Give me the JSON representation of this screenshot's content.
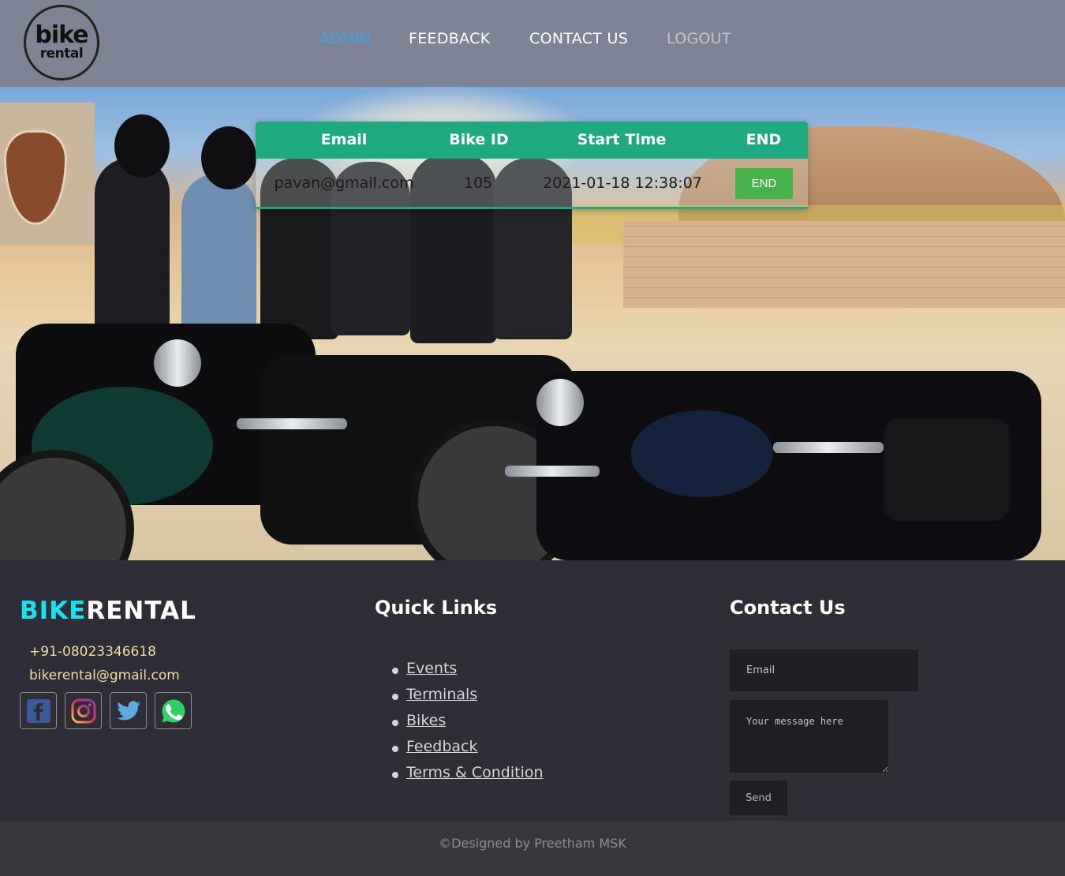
{
  "logo": {
    "line1": "bike",
    "line2": "rental"
  },
  "nav": {
    "admin": "ADMIN",
    "feedback": "FEEDBACK",
    "contact": "CONTACT US",
    "logout": "LOGOUT"
  },
  "table": {
    "headers": [
      "Email",
      "Bike ID",
      "Start Time",
      "END"
    ],
    "rows": [
      {
        "email": "pavan@gmail.com",
        "bike_id": "105",
        "start_time": "2021-01-18 12:38:07",
        "action": "END"
      }
    ]
  },
  "footer": {
    "brand_part1": "BIKE",
    "brand_part2": "RENTAL",
    "phone": "+91-08023346618",
    "email": "bikerental@gmail.com",
    "socials": [
      "facebook-icon",
      "instagram-icon",
      "twitter-icon",
      "whatsapp-icon"
    ],
    "quick_links_title": "Quick Links",
    "quick_links": [
      "Events",
      "Terminals",
      "Bikes",
      "Feedback",
      "Terms & Condition"
    ],
    "contact_title": "Contact Us",
    "email_placeholder": "Email",
    "message_placeholder": "Your message here",
    "send_label": "Send"
  },
  "copyright": "©Designed by Preetham MSK",
  "colors": {
    "header_bg": "#7e8396",
    "nav_active": "#3aa5e0",
    "table_header": "#1ea980",
    "end_button": "#48b34a",
    "brand_accent": "#14e4ee",
    "footer_bg": "#2f2e36"
  }
}
